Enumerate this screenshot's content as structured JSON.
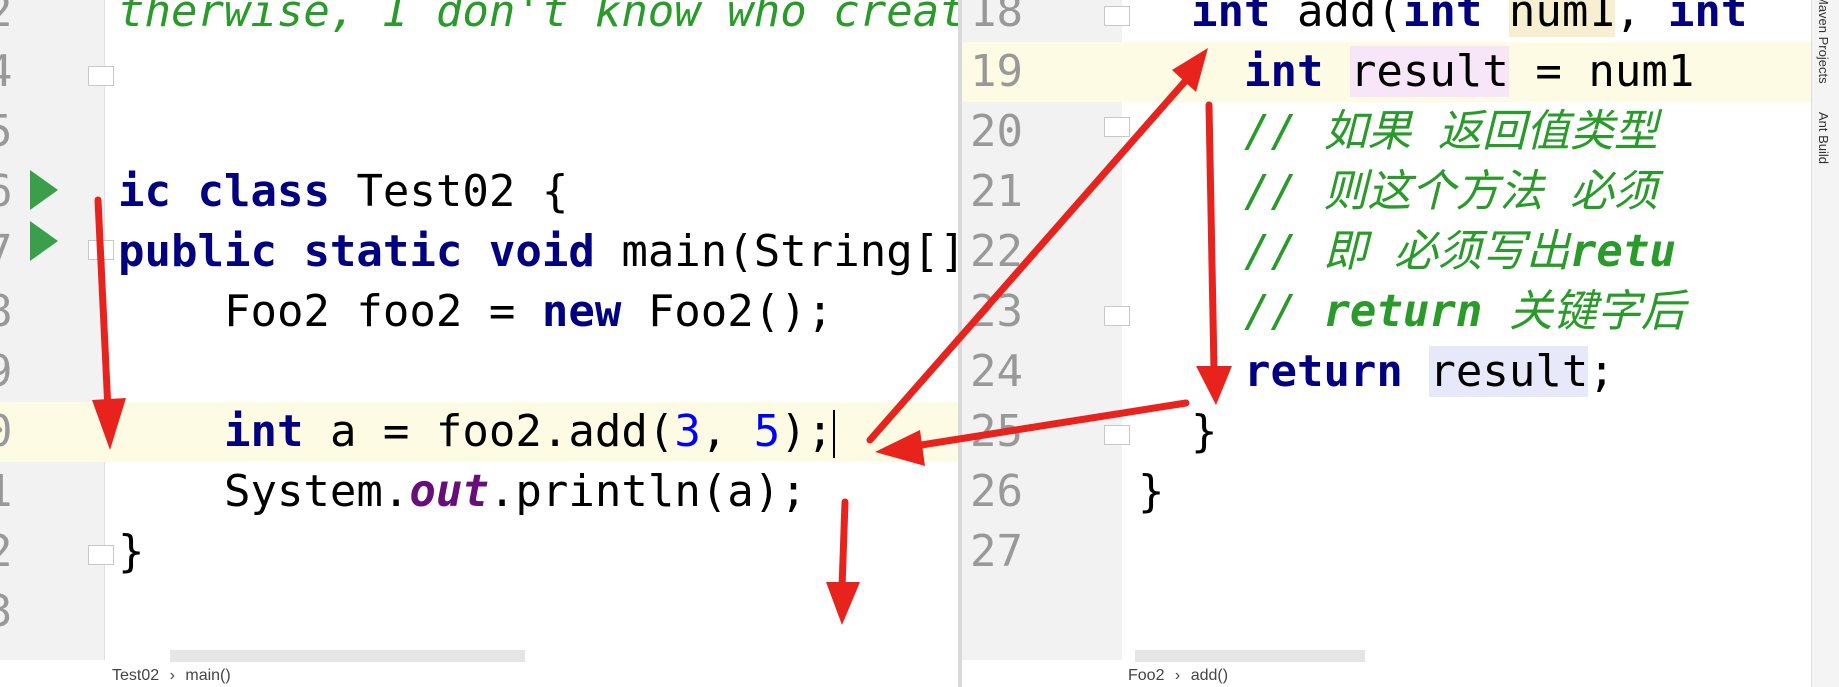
{
  "left_editor": {
    "lines": [
      {
        "num": "2",
        "tokens": [
          {
            "t": "therwise, I don't know who creat",
            "c": "cm"
          }
        ]
      },
      {
        "num": "4",
        "tokens": []
      },
      {
        "num": "5",
        "tokens": []
      },
      {
        "num": "6",
        "tokens": [
          {
            "t": "ic ",
            "c": "kw"
          },
          {
            "t": "class ",
            "c": "kw"
          },
          {
            "t": "Test02 {",
            "c": ""
          }
        ]
      },
      {
        "num": "7",
        "tokens": [
          {
            "t": "public ",
            "c": "kw"
          },
          {
            "t": "static ",
            "c": "kw"
          },
          {
            "t": "void ",
            "c": "kw"
          },
          {
            "t": "main(String[]",
            "c": ""
          }
        ]
      },
      {
        "num": "8",
        "tokens": [
          {
            "t": "    Foo2 foo2 = ",
            "c": ""
          },
          {
            "t": "new ",
            "c": "kw"
          },
          {
            "t": "Foo2();",
            "c": ""
          }
        ]
      },
      {
        "num": "9",
        "tokens": []
      },
      {
        "num": "0",
        "tokens": [
          {
            "t": "    ",
            "c": ""
          },
          {
            "t": "int ",
            "c": "kw"
          },
          {
            "t": "a = foo2.add(",
            "c": ""
          },
          {
            "t": "3",
            "c": "num"
          },
          {
            "t": ", ",
            "c": ""
          },
          {
            "t": "5",
            "c": "num"
          },
          {
            "t": ");",
            "c": ""
          }
        ],
        "highlight": true,
        "caret": true
      },
      {
        "num": "1",
        "tokens": [
          {
            "t": "    System.",
            "c": ""
          },
          {
            "t": "out",
            "c": "st"
          },
          {
            "t": ".println(a);",
            "c": ""
          }
        ]
      },
      {
        "num": "2",
        "tokens": [
          {
            "t": "}",
            "c": ""
          }
        ]
      },
      {
        "num": "3",
        "tokens": []
      }
    ]
  },
  "right_editor": {
    "lines": [
      {
        "num": "18",
        "tokens": [
          {
            "t": "  ",
            "c": ""
          },
          {
            "t": "int ",
            "c": "kw"
          },
          {
            "t": "add(",
            "c": ""
          },
          {
            "t": "int ",
            "c": "kw"
          },
          {
            "t": "num1",
            "c": "hlv"
          },
          {
            "t": ", ",
            "c": ""
          },
          {
            "t": "int",
            "c": "kw"
          }
        ]
      },
      {
        "num": "19",
        "tokens": [
          {
            "t": "    ",
            "c": ""
          },
          {
            "t": "int ",
            "c": "kw"
          },
          {
            "t": "result",
            "c": "hlr"
          },
          {
            "t": " = num1",
            "c": ""
          }
        ],
        "highlight": true
      },
      {
        "num": "20",
        "tokens": [
          {
            "t": "    // 如果 返回值类型",
            "c": "cm"
          }
        ]
      },
      {
        "num": "21",
        "tokens": [
          {
            "t": "    // 则这个方法 必须",
            "c": "cm"
          }
        ]
      },
      {
        "num": "22",
        "tokens": [
          {
            "t": "    // 即 必须写出",
            "c": "cm"
          },
          {
            "t": "retu",
            "c": "cmb"
          }
        ]
      },
      {
        "num": "23",
        "tokens": [
          {
            "t": "    // ",
            "c": "cm"
          },
          {
            "t": "return",
            "c": "cmb"
          },
          {
            "t": " 关键字后",
            "c": "cm"
          }
        ]
      },
      {
        "num": "24",
        "tokens": [
          {
            "t": "    ",
            "c": ""
          },
          {
            "t": "return ",
            "c": "kw"
          },
          {
            "t": "result",
            "c": "hlu"
          },
          {
            "t": ";",
            "c": ""
          }
        ]
      },
      {
        "num": "25",
        "tokens": [
          {
            "t": "  }",
            "c": ""
          }
        ]
      },
      {
        "num": "26",
        "tokens": [
          {
            "t": "}",
            "c": ""
          }
        ]
      },
      {
        "num": "27",
        "tokens": []
      }
    ]
  },
  "left_breadcrumb": {
    "class_name": "Test02",
    "method_name": "main()"
  },
  "right_breadcrumb": {
    "class_name": "Foo2",
    "method_name": "add()"
  },
  "side_tabs": {
    "maven": "Maven Projects",
    "ant": "Ant Build"
  },
  "colors": {
    "keyword": "#000080",
    "number": "#0000ff",
    "comment": "#2a9b2a",
    "static_field": "#660e7a",
    "annotation_arrow": "#e8231d",
    "line_highlight": "#fdfbe3"
  }
}
